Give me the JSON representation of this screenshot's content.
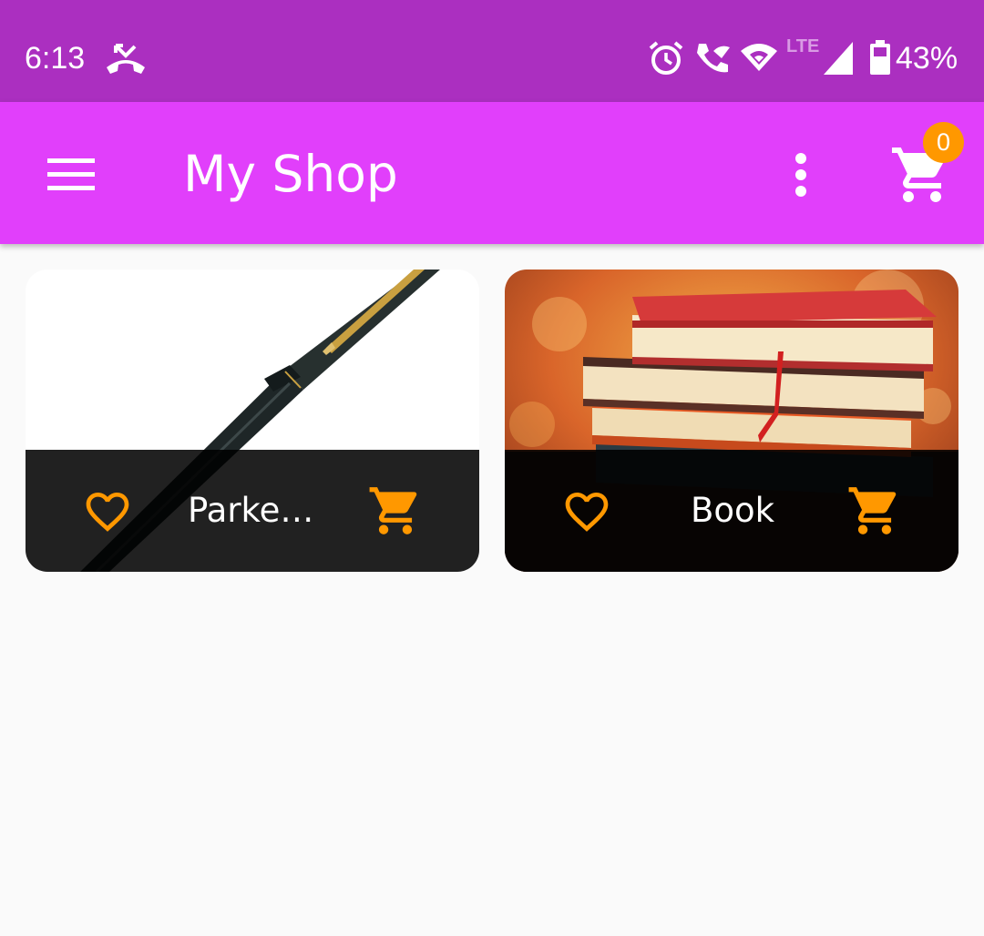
{
  "status_bar": {
    "time": "6:13",
    "network": "LTE",
    "battery": "43%",
    "icons": [
      "missed-call-icon",
      "alarm-icon",
      "wifi-calling-icon",
      "wifi-icon",
      "cell-signal-icon",
      "battery-icon"
    ]
  },
  "app_bar": {
    "title": "My Shop",
    "cart_count": "0",
    "icons": [
      "menu-icon",
      "more-vert-icon",
      "shopping-cart-icon"
    ]
  },
  "colors": {
    "status_bar": "#ab2fc0",
    "app_bar": "#e13ffb",
    "accent": "#ff9800",
    "background": "#fafafa"
  },
  "products": [
    {
      "title": "Parker Pen",
      "image": "pen-image"
    },
    {
      "title": "Book",
      "image": "books-image"
    }
  ]
}
